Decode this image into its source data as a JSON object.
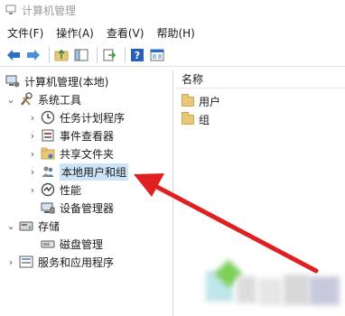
{
  "window": {
    "title": "计算机管理"
  },
  "menu": {
    "items": [
      {
        "label": "文件(F)"
      },
      {
        "label": "操作(A)"
      },
      {
        "label": "查看(V)"
      },
      {
        "label": "帮助(H)"
      }
    ]
  },
  "toolbar": {
    "buttons": [
      {
        "icon": "back-arrow-icon"
      },
      {
        "icon": "forward-arrow-icon"
      },
      {
        "icon": "up-folder-icon"
      },
      {
        "icon": "show-hide-tree-icon"
      },
      {
        "icon": "export-list-icon"
      },
      {
        "icon": "help-icon"
      },
      {
        "icon": "properties-icon"
      }
    ]
  },
  "tree": {
    "root": {
      "label": "计算机管理(本地)",
      "icon": "computer-management-icon"
    },
    "system_tools": {
      "label": "系统工具",
      "icon": "tools-icon"
    },
    "task_scheduler": {
      "label": "任务计划程序",
      "icon": "clock-icon"
    },
    "event_viewer": {
      "label": "事件查看器",
      "icon": "event-viewer-icon"
    },
    "shared_folders": {
      "label": "共享文件夹",
      "icon": "shared-folder-icon"
    },
    "local_users": {
      "label": "本地用户和组",
      "icon": "users-icon",
      "selected": true
    },
    "performance": {
      "label": "性能",
      "icon": "performance-icon"
    },
    "device_manager": {
      "label": "设备管理器",
      "icon": "device-manager-icon"
    },
    "storage": {
      "label": "存储",
      "icon": "storage-icon"
    },
    "disk_management": {
      "label": "磁盘管理",
      "icon": "disk-icon"
    },
    "services": {
      "label": "服务和应用程序",
      "icon": "services-icon"
    }
  },
  "list": {
    "column_header": "名称",
    "items": [
      {
        "label": "用户",
        "icon": "folder-icon"
      },
      {
        "label": "组",
        "icon": "folder-icon"
      }
    ]
  },
  "colors": {
    "arrow": "#e02020",
    "selection": "#cce4f7",
    "folder": "#e8c879"
  }
}
